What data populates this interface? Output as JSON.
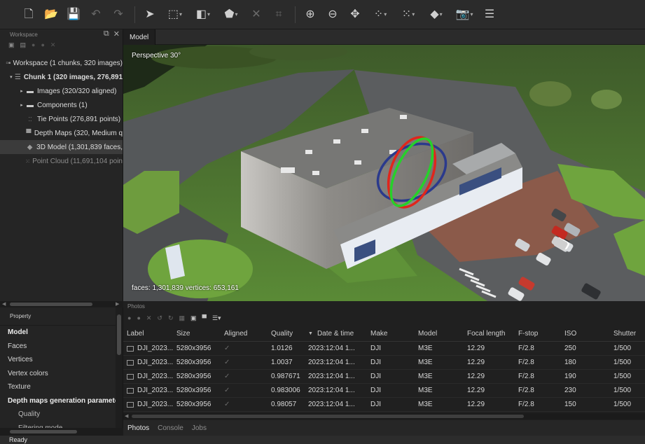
{
  "toolbar": {
    "buttons": [
      {
        "name": "new-project-icon",
        "glyph": "🗋",
        "dim": false
      },
      {
        "name": "open-folder-icon",
        "glyph": "📂",
        "dim": false
      },
      {
        "name": "save-icon",
        "glyph": "💾",
        "dim": false
      },
      {
        "name": "undo-icon",
        "glyph": "↶",
        "dim": true
      },
      {
        "name": "redo-icon",
        "glyph": "↷",
        "dim": true
      },
      {
        "name": "navigation-arrow-icon",
        "glyph": "➤",
        "dim": false
      },
      {
        "name": "rectangle-selection-icon",
        "glyph": "⬚",
        "dim": false,
        "dropdown": true
      },
      {
        "name": "model-tools-icon",
        "glyph": "◧",
        "dim": false,
        "dropdown": true
      },
      {
        "name": "shape-tools-icon",
        "glyph": "⬟",
        "dim": false,
        "dropdown": true
      },
      {
        "name": "delete-selection-icon",
        "glyph": "✕",
        "dim": true
      },
      {
        "name": "crop-selection-icon",
        "glyph": "⌗",
        "dim": true
      },
      {
        "name": "zoom-in-icon",
        "glyph": "⊕",
        "dim": false
      },
      {
        "name": "zoom-out-icon",
        "glyph": "⊖",
        "dim": false
      },
      {
        "name": "reset-view-icon",
        "glyph": "✥",
        "dim": false
      },
      {
        "name": "show-cameras-icon",
        "glyph": "⁘",
        "dim": false,
        "dropdown": true
      },
      {
        "name": "show-points-icon",
        "glyph": "⁙",
        "dim": false,
        "dropdown": true
      },
      {
        "name": "model-view-mode-icon",
        "glyph": "◆",
        "dim": false,
        "dropdown": true
      },
      {
        "name": "camera-icon",
        "glyph": "📷",
        "dim": false,
        "dropdown": true
      },
      {
        "name": "region-icon",
        "glyph": "☰",
        "dim": false
      }
    ]
  },
  "workspace": {
    "title": "Workspace",
    "tree": [
      {
        "label": "Workspace (1 chunks, 320 images)",
        "icon": "workspace-icon",
        "glyph": "▫▪",
        "indent": 6,
        "caret": "",
        "bold": false,
        "selected": false
      },
      {
        "label": "Chunk 1 (320 images, 276,891",
        "icon": "chunk-icon",
        "glyph": "☰",
        "indent": 12,
        "caret": "▾",
        "bold": true,
        "selected": false
      },
      {
        "label": "Images (320/320 aligned)",
        "icon": "folder-icon",
        "glyph": "▬",
        "indent": 26,
        "caret": "▸",
        "bold": false,
        "selected": false
      },
      {
        "label": "Components (1)",
        "icon": "folder-icon",
        "glyph": "▬",
        "indent": 26,
        "caret": "▸",
        "bold": false,
        "selected": false
      },
      {
        "label": "Tie Points (276,891 points)",
        "icon": "tie-points-icon",
        "glyph": "⁚⁚",
        "indent": 36,
        "caret": "",
        "bold": false,
        "selected": false
      },
      {
        "label": "Depth Maps (320, Medium q",
        "icon": "depth-maps-icon",
        "glyph": "▀",
        "indent": 36,
        "caret": "",
        "bold": false,
        "selected": false
      },
      {
        "label": "3D Model (1,301,839 faces,",
        "icon": "3d-model-icon",
        "glyph": "◆",
        "indent": 36,
        "caret": "",
        "bold": false,
        "selected": true
      },
      {
        "label": "Point Cloud (11,691,104 poin",
        "icon": "point-cloud-icon",
        "glyph": "⁙",
        "indent": 36,
        "caret": "",
        "bold": false,
        "selected": false,
        "dim": true
      }
    ]
  },
  "viewport": {
    "tab": "Model",
    "projection": "Perspective 30°",
    "stats": "faces: 1,301,839 vertices: 653,161"
  },
  "property": {
    "header": "Property",
    "rows": [
      {
        "label": "Model",
        "style": "b"
      },
      {
        "label": "Faces",
        "style": ""
      },
      {
        "label": "Vertices",
        "style": ""
      },
      {
        "label": "Vertex colors",
        "style": ""
      },
      {
        "label": "Texture",
        "style": ""
      },
      {
        "label": "Depth maps generation parameters",
        "style": "b"
      },
      {
        "label": "Quality",
        "style": "ind"
      },
      {
        "label": "Filtering mode",
        "style": "ind"
      }
    ]
  },
  "photos": {
    "title": "Photos",
    "columns": [
      {
        "key": "label",
        "title": "Label"
      },
      {
        "key": "size",
        "title": "Size"
      },
      {
        "key": "aligned",
        "title": "Aligned"
      },
      {
        "key": "quality",
        "title": "Quality"
      },
      {
        "key": "datetime",
        "title": "Date & time"
      },
      {
        "key": "make",
        "title": "Make"
      },
      {
        "key": "model",
        "title": "Model"
      },
      {
        "key": "focal",
        "title": "Focal length"
      },
      {
        "key": "fstop",
        "title": "F-stop"
      },
      {
        "key": "iso",
        "title": "ISO"
      },
      {
        "key": "shutter",
        "title": "Shutter"
      }
    ],
    "rows": [
      {
        "label": "DJI_2023...",
        "size": "5280x3956",
        "aligned": "✓",
        "quality": "1.0126",
        "datetime": "2023:12:04 1...",
        "make": "DJI",
        "model": "M3E",
        "focal": "12.29",
        "fstop": "F/2.8",
        "iso": "250",
        "shutter": "1/500"
      },
      {
        "label": "DJI_2023...",
        "size": "5280x3956",
        "aligned": "✓",
        "quality": "1.0037",
        "datetime": "2023:12:04 1...",
        "make": "DJI",
        "model": "M3E",
        "focal": "12.29",
        "fstop": "F/2.8",
        "iso": "180",
        "shutter": "1/500"
      },
      {
        "label": "DJI_2023...",
        "size": "5280x3956",
        "aligned": "✓",
        "quality": "0.987671",
        "datetime": "2023:12:04 1...",
        "make": "DJI",
        "model": "M3E",
        "focal": "12.29",
        "fstop": "F/2.8",
        "iso": "190",
        "shutter": "1/500"
      },
      {
        "label": "DJI_2023...",
        "size": "5280x3956",
        "aligned": "✓",
        "quality": "0.983006",
        "datetime": "2023:12:04 1...",
        "make": "DJI",
        "model": "M3E",
        "focal": "12.29",
        "fstop": "F/2.8",
        "iso": "230",
        "shutter": "1/500"
      },
      {
        "label": "DJI_2023...",
        "size": "5280x3956",
        "aligned": "✓",
        "quality": "0.98057",
        "datetime": "2023:12:04 1...",
        "make": "DJI",
        "model": "M3E",
        "focal": "12.29",
        "fstop": "F/2.8",
        "iso": "150",
        "shutter": "1/500"
      }
    ],
    "bottom_tabs": [
      "Photos",
      "Console",
      "Jobs"
    ],
    "active_tab": "Photos"
  },
  "status": "Ready",
  "colors": {
    "background": "#222222",
    "panel": "#252525",
    "selected_row": "#3b3b3b",
    "grass": "#5c8a3a",
    "roof": "#7b7b7b",
    "gizmo_red": "#e0261c",
    "gizmo_green": "#26d12a",
    "gizmo_blue": "#2b3a8c"
  }
}
